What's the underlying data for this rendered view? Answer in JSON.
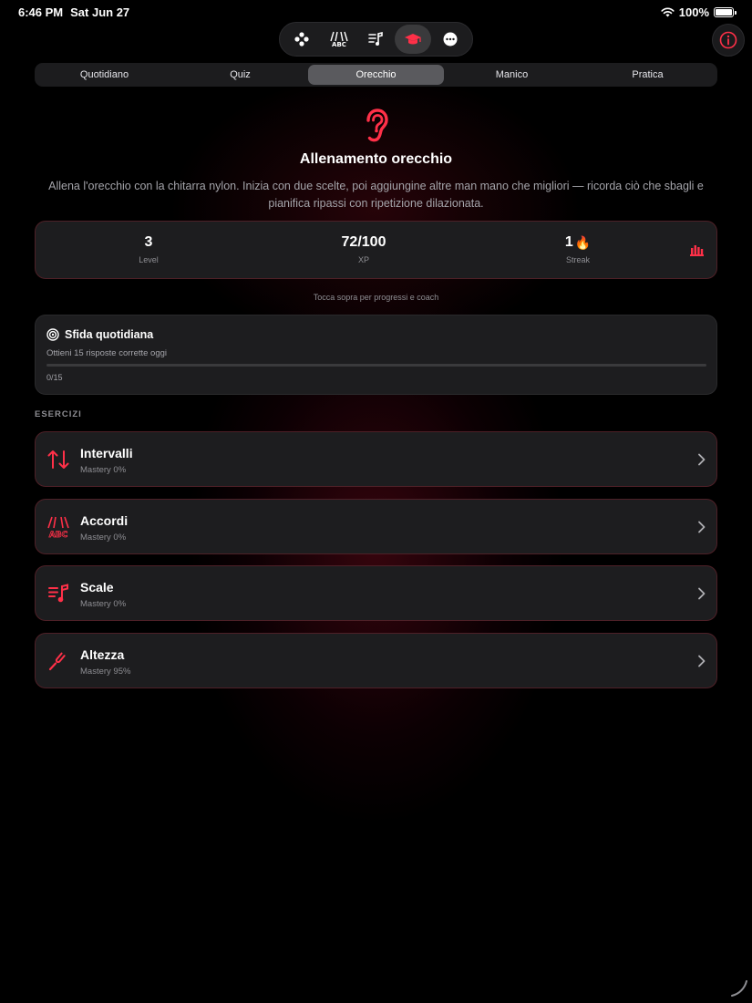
{
  "status_bar": {
    "time": "6:46 PM",
    "date": "Sat Jun 27",
    "battery": "100%"
  },
  "top_nav": {
    "items": [
      {
        "name": "game",
        "icon": "gamepad-icon"
      },
      {
        "name": "chords",
        "icon": "guitar-abc-icon"
      },
      {
        "name": "scales",
        "icon": "music-list-icon"
      },
      {
        "name": "learn",
        "icon": "graduation-cap-icon",
        "active": true
      },
      {
        "name": "more",
        "icon": "ellipsis-icon"
      }
    ]
  },
  "tabs": [
    {
      "label": "Quotidiano",
      "active": false
    },
    {
      "label": "Quiz",
      "active": false
    },
    {
      "label": "Orecchio",
      "active": true
    },
    {
      "label": "Manico",
      "active": false
    },
    {
      "label": "Pratica",
      "active": false
    }
  ],
  "header": {
    "title": "Allenamento orecchio",
    "description": "Allena l'orecchio con la chitarra nylon. Inizia con due scelte, poi aggiungine altre man mano che migliori — ricorda ciò che sbagli e pianifica ripassi con ripetizione dilazionata."
  },
  "stats": {
    "level": {
      "value": "3",
      "label": "Level"
    },
    "xp": {
      "value": "72/100",
      "label": "XP"
    },
    "streak": {
      "value": "1",
      "emoji": "🔥",
      "label": "Streak"
    },
    "hint": "Tocca sopra per progressi e coach"
  },
  "challenge": {
    "title": "Sfida quotidiana",
    "subtitle": "Ottieni 15 risposte corrette oggi",
    "progress": 0,
    "count": "0/15"
  },
  "section_label": "ESERCIZI",
  "exercises": [
    {
      "name": "Intervalli",
      "mastery": "Mastery 0%",
      "icon": "arrows-up-down-icon"
    },
    {
      "name": "Accordi",
      "mastery": "Mastery 0%",
      "icon": "guitar-abc-icon"
    },
    {
      "name": "Scale",
      "mastery": "Mastery 0%",
      "icon": "music-list-icon"
    },
    {
      "name": "Altezza",
      "mastery": "Mastery 95%",
      "icon": "tuning-fork-icon"
    }
  ],
  "colors": {
    "accent": "#ff3048",
    "background": "#000000",
    "card": "#1d1d1f"
  }
}
